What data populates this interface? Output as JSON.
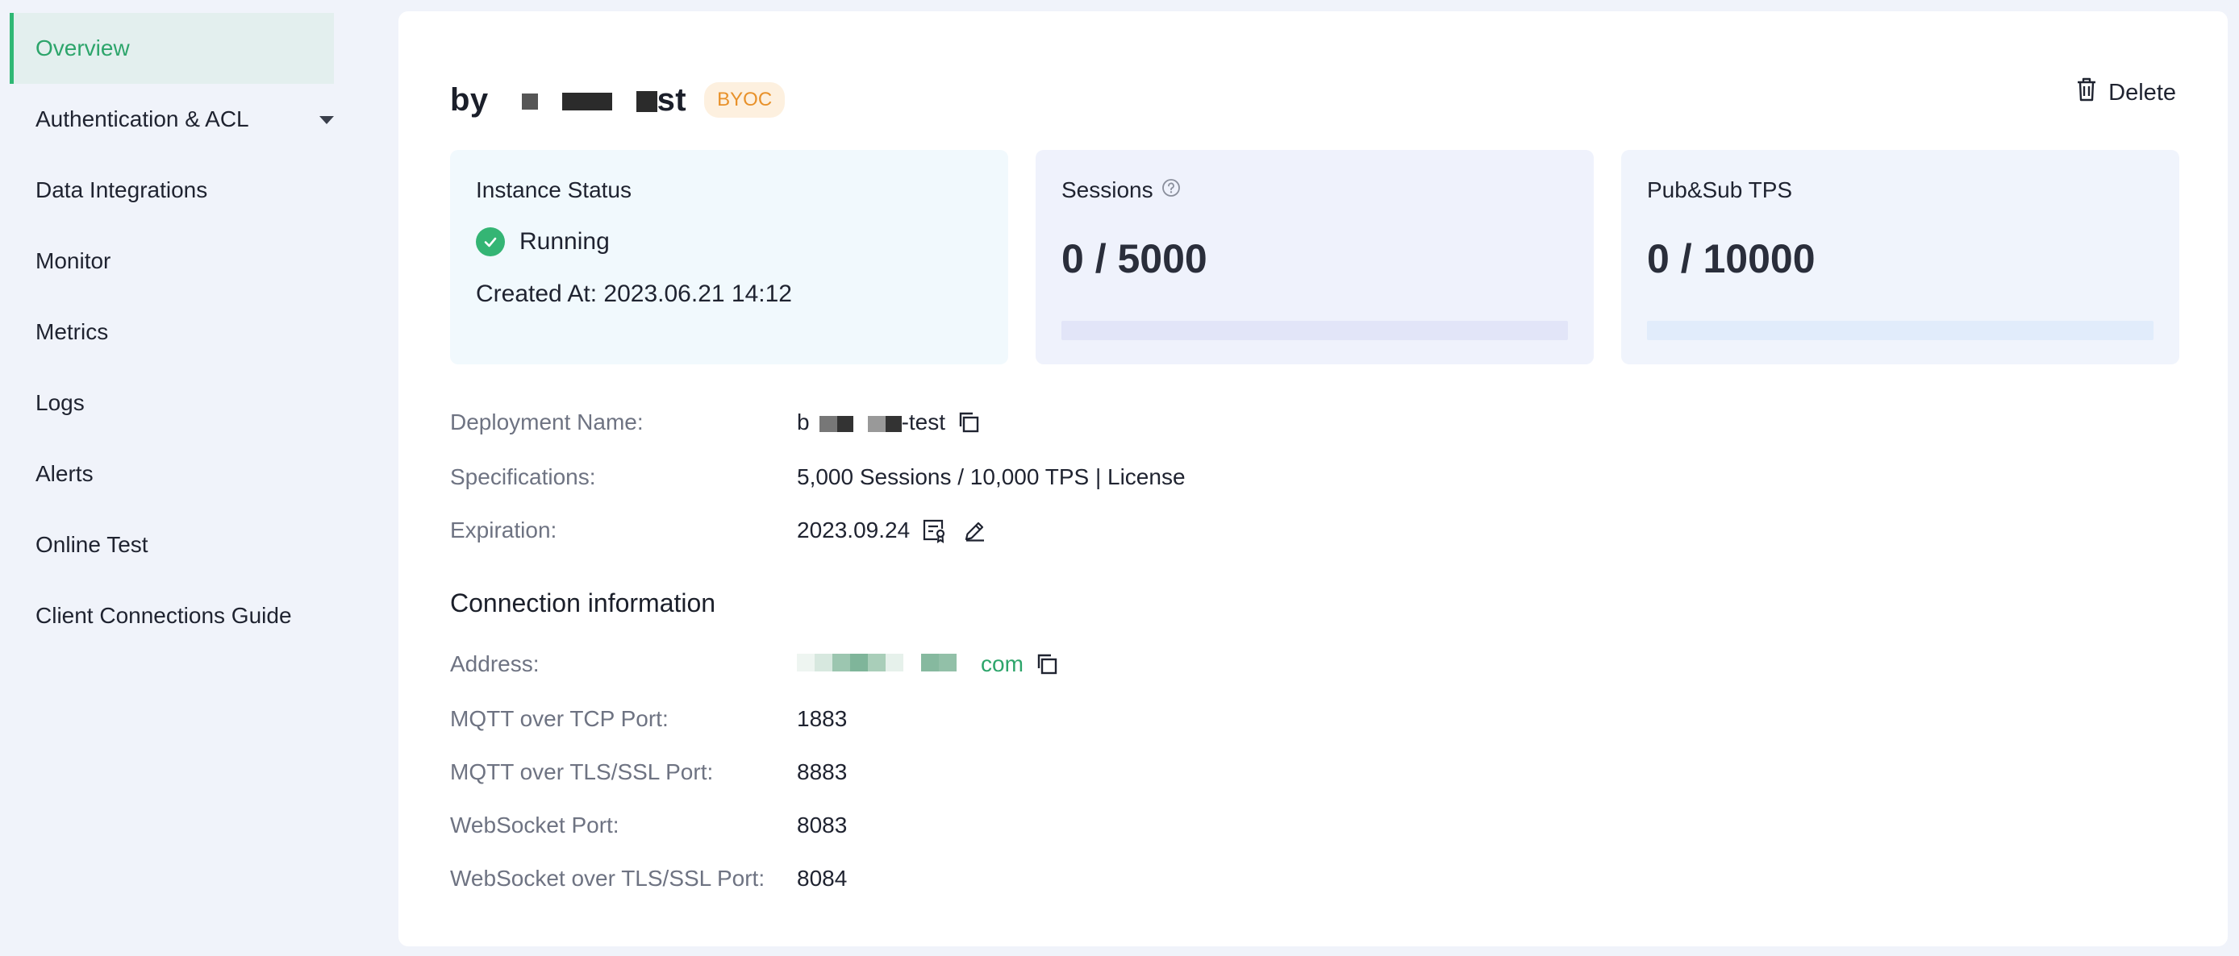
{
  "sidebar": {
    "items": [
      {
        "label": "Overview",
        "active": true
      },
      {
        "label": "Authentication & ACL",
        "has_caret": true
      },
      {
        "label": "Data Integrations"
      },
      {
        "label": "Monitor"
      },
      {
        "label": "Metrics"
      },
      {
        "label": "Logs"
      },
      {
        "label": "Alerts"
      },
      {
        "label": "Online Test"
      },
      {
        "label": "Client Connections Guide"
      }
    ]
  },
  "header": {
    "title_start": "by",
    "title_end": "st",
    "badge": "BYOC",
    "delete_label": "Delete"
  },
  "status_card": {
    "label": "Instance Status",
    "status": "Running",
    "created": "Created At: 2023.06.21 14:12"
  },
  "sessions_card": {
    "label": "Sessions",
    "value": "0 / 5000",
    "progress": 0
  },
  "tps_card": {
    "label": "Pub&Sub TPS",
    "value": "0 / 10000",
    "progress": 0
  },
  "details": {
    "deployment_name_label": "Deployment Name:",
    "deployment_name_start": "b",
    "deployment_name_end": "-test",
    "specifications_label": "Specifications:",
    "specifications_value": "5,000 Sessions / 10,000 TPS | License",
    "expiration_label": "Expiration:",
    "expiration_value": "2023.09.24"
  },
  "connection": {
    "title": "Connection information",
    "address_label": "Address:",
    "address_end": "com",
    "tcp_label": "MQTT over TCP Port:",
    "tcp_value": "1883",
    "tls_label": "MQTT over TLS/SSL Port:",
    "tls_value": "8883",
    "ws_label": "WebSocket Port:",
    "ws_value": "8083",
    "wss_label": "WebSocket over TLS/SSL Port:",
    "wss_value": "8084"
  },
  "colors": {
    "accent": "#2fb874",
    "link": "#2da56b",
    "badge_text": "#e8912a",
    "badge_bg": "#fdf0df"
  }
}
